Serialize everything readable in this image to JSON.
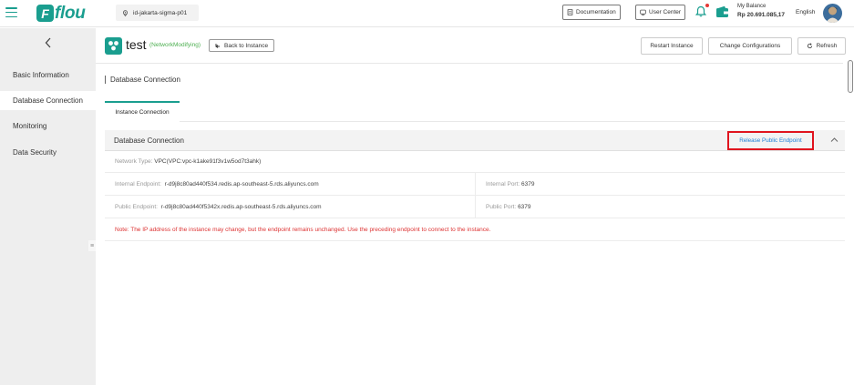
{
  "header": {
    "logo_text": "flou",
    "region": "id-jakarta-sigma-p01",
    "documentation_label": "Documentation",
    "user_center_label": "User Center",
    "balance_label": "My Balance",
    "balance_value": "Rp 20.691.085,17",
    "language": "English"
  },
  "sidebar": {
    "items": [
      {
        "label": "Basic Information"
      },
      {
        "label": "Database Connection"
      },
      {
        "label": "Monitoring"
      },
      {
        "label": "Data Security"
      }
    ]
  },
  "instance": {
    "name": "test",
    "status": "(NetworkModifying)",
    "back_label": "Back to Instance",
    "restart_label": "Restart Instance",
    "change_config_label": "Change Configurations",
    "refresh_label": "Refresh"
  },
  "page": {
    "section_title": "Database Connection",
    "tab_label": "Instance Connection"
  },
  "connection": {
    "panel_title": "Database Connection",
    "release_label": "Release Public Endpoint",
    "network_type_label": "Network Type:",
    "network_type_value": "VPC(VPC:vpc-k1ake91f3v1w5od7t3ahk)",
    "internal_endpoint_label": "Internal Endpoint:",
    "internal_endpoint_value": "r-d9j8c80ad440f534.redis.ap-southeast-5.rds.aliyuncs.com",
    "internal_port_label": "Internal Port:",
    "internal_port_value": "6379",
    "public_endpoint_label": "Public Endpoint:",
    "public_endpoint_value": "r-d9j8c80ad440f5342x.redis.ap-southeast-5.rds.aliyuncs.com",
    "public_port_label": "Public Port:",
    "public_port_value": "6379",
    "note": "Note:  The IP address of the instance may change, but the endpoint remains unchanged. Use the preceding endpoint to connect to the instance."
  },
  "colors": {
    "brand": "#1a9e8f",
    "link": "#1e7fd6",
    "highlight_border": "#e0141e",
    "note_text": "#d33333",
    "status_text": "#4caf50"
  },
  "icons": [
    "menu-icon",
    "location-pin-icon",
    "document-icon",
    "user-center-icon",
    "bell-icon",
    "wallet-icon",
    "chevron-left-icon",
    "back-arrow-icon",
    "refresh-icon",
    "chevron-up-icon",
    "instance-icon",
    "sidebar-toggle-icon"
  ]
}
